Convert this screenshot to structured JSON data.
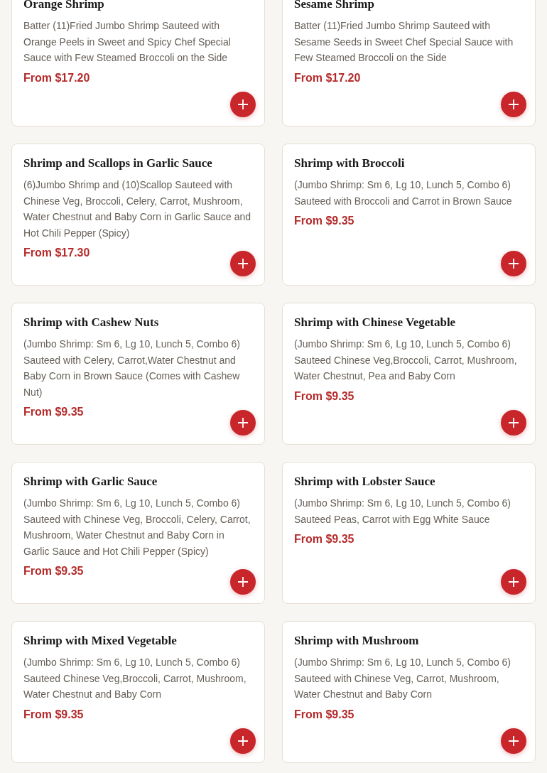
{
  "menu_items": [
    {
      "name": "Orange Shrimp",
      "description": "Batter (11)Fried Jumbo Shrimp Sauteed with Orange Peels in Sweet and Spicy Chef Special Sauce with Few Steamed Broccoli on the Side",
      "price": "From $17.20"
    },
    {
      "name": "Sesame Shrimp",
      "description": "Batter (11)Fried Jumbo Shrimp Sauteed with Sesame Seeds in Sweet Chef Special Sauce with Few Steamed Broccoli on the Side",
      "price": "From $17.20"
    },
    {
      "name": "Shrimp and Scallops in Garlic Sauce",
      "description": "(6)Jumbo Shrimp and (10)Scallop Sauteed with Chinese Veg, Broccoli, Celery, Carrot, Mushroom, Water Chestnut and Baby Corn in Garlic Sauce and Hot Chili Pepper (Spicy)",
      "price": "From $17.30"
    },
    {
      "name": "Shrimp with Broccoli",
      "description": "(Jumbo Shrimp: Sm 6, Lg 10, Lunch 5, Combo 6) Sauteed with Broccoli and Carrot in Brown Sauce",
      "price": "From $9.35"
    },
    {
      "name": "Shrimp with Cashew Nuts",
      "description": "(Jumbo Shrimp: Sm 6, Lg 10, Lunch 5, Combo 6) Sauteed with Celery, Carrot,Water Chestnut and Baby Corn in Brown Sauce (Comes with Cashew Nut)",
      "price": "From $9.35"
    },
    {
      "name": "Shrimp with Chinese Vegetable",
      "description": "(Jumbo Shrimp: Sm 6, Lg 10, Lunch 5, Combo 6) Sauteed Chinese Veg,Broccoli, Carrot, Mushroom, Water Chestnut, Pea and Baby Corn",
      "price": "From $9.35"
    },
    {
      "name": "Shrimp with Garlic Sauce",
      "description": "(Jumbo Shrimp: Sm 6, Lg 10, Lunch 5, Combo 6) Sauteed with Chinese Veg, Broccoli, Celery, Carrot, Mushroom, Water Chestnut and Baby Corn in Garlic Sauce and Hot Chili Pepper (Spicy)",
      "price": "From $9.35"
    },
    {
      "name": "Shrimp with Lobster Sauce",
      "description": "(Jumbo Shrimp: Sm 6, Lg 10, Lunch 5, Combo 6) Sauteed Peas, Carrot with Egg White Sauce",
      "price": "From $9.35"
    },
    {
      "name": "Shrimp with Mixed Vegetable",
      "description": "(Jumbo Shrimp: Sm 6, Lg 10, Lunch 5, Combo 6) Sauteed Chinese Veg,Broccoli, Carrot, Mushroom, Water Chestnut and Baby Corn",
      "price": "From $9.35"
    },
    {
      "name": "Shrimp with Mushroom",
      "description": "(Jumbo Shrimp: Sm 6, Lg 10, Lunch 5, Combo 6) Sauteed with Chinese Veg, Carrot, Mushroom, Water Chestnut and Baby Corn",
      "price": "From $9.35"
    }
  ]
}
